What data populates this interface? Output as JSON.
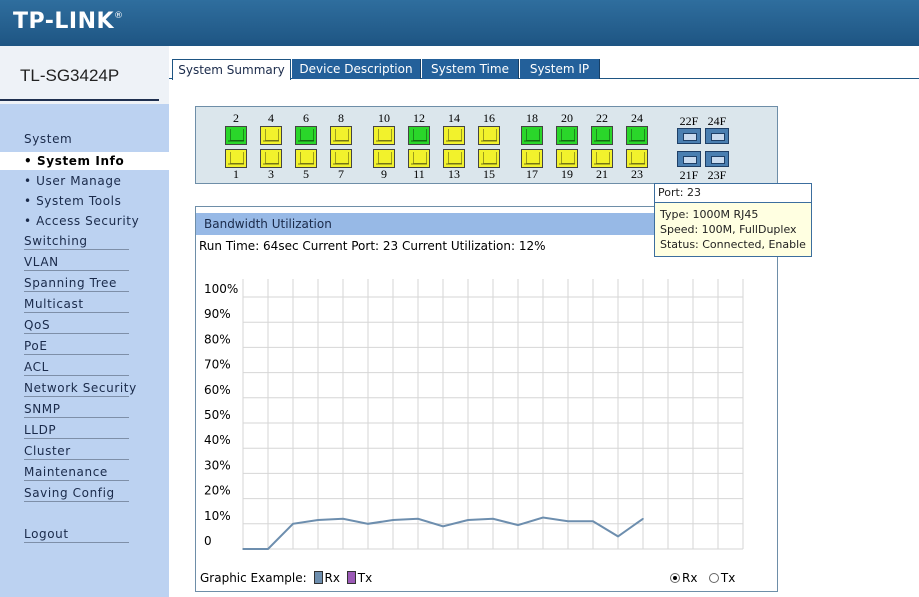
{
  "header": {
    "logo": "TP-LINK",
    "logo_mark": "®"
  },
  "device": {
    "model": "TL-SG3424P"
  },
  "tabs": [
    {
      "label": "System Summary",
      "active": true
    },
    {
      "label": "Device Description",
      "active": false
    },
    {
      "label": "System Time",
      "active": false
    },
    {
      "label": "System IP",
      "active": false
    }
  ],
  "sidebar": {
    "items": [
      {
        "label": "System",
        "sub": false
      },
      {
        "label": "• System Info",
        "sub": true,
        "active": true
      },
      {
        "label": "• User Manage",
        "sub": true
      },
      {
        "label": "• System Tools",
        "sub": true
      },
      {
        "label": "• Access Security",
        "sub": true
      },
      {
        "label": "Switching"
      },
      {
        "label": "VLAN"
      },
      {
        "label": "Spanning Tree"
      },
      {
        "label": "Multicast"
      },
      {
        "label": "QoS"
      },
      {
        "label": "PoE"
      },
      {
        "label": "ACL"
      },
      {
        "label": "Network Security"
      },
      {
        "label": "SNMP"
      },
      {
        "label": "LLDP"
      },
      {
        "label": "Cluster"
      },
      {
        "label": "Maintenance"
      },
      {
        "label": "Saving Config"
      },
      {
        "label": "Logout"
      }
    ]
  },
  "ports": {
    "top": [
      {
        "num": "2",
        "status": "green"
      },
      {
        "num": "4",
        "status": "yellow"
      },
      {
        "num": "6",
        "status": "green"
      },
      {
        "num": "8",
        "status": "yellow"
      },
      {
        "num": "10",
        "status": "yellow"
      },
      {
        "num": "12",
        "status": "green"
      },
      {
        "num": "14",
        "status": "yellow"
      },
      {
        "num": "16",
        "status": "yellow"
      },
      {
        "num": "18",
        "status": "green"
      },
      {
        "num": "20",
        "status": "green"
      },
      {
        "num": "22",
        "status": "green"
      },
      {
        "num": "24",
        "status": "green"
      }
    ],
    "bottom": [
      {
        "num": "1",
        "status": "yellow"
      },
      {
        "num": "3",
        "status": "yellow"
      },
      {
        "num": "5",
        "status": "yellow"
      },
      {
        "num": "7",
        "status": "yellow"
      },
      {
        "num": "9",
        "status": "yellow"
      },
      {
        "num": "11",
        "status": "yellow"
      },
      {
        "num": "13",
        "status": "yellow"
      },
      {
        "num": "15",
        "status": "yellow"
      },
      {
        "num": "17",
        "status": "yellow"
      },
      {
        "num": "19",
        "status": "yellow"
      },
      {
        "num": "21",
        "status": "yellow"
      },
      {
        "num": "23",
        "status": "yellow"
      }
    ],
    "sfp_top": [
      "22F",
      "24F"
    ],
    "sfp_bottom": [
      "21F",
      "23F"
    ]
  },
  "tooltip": {
    "title": "Port: 23",
    "type": "Type: 1000M RJ45",
    "speed": "Speed: 100M, FullDuplex",
    "status": "Status: Connected, Enable"
  },
  "bandwidth": {
    "title": "Bandwidth Utilization",
    "run_info": "Run Time: 64sec Current Port: 23 Current Utilization: 12%",
    "legend_label": "Graphic Example:",
    "rx_label": "Rx",
    "tx_label": "Tx",
    "rx_color": "#6d8eae",
    "tx_color": "#9b59b6",
    "radio_rx": "Rx",
    "radio_tx": "Tx",
    "selected": "Rx"
  },
  "chart_data": {
    "type": "line",
    "y_ticks": [
      "100%",
      "90%",
      "80%",
      "70%",
      "60%",
      "50%",
      "40%",
      "30%",
      "20%",
      "10%",
      "0"
    ],
    "ylim": [
      0,
      100
    ],
    "grid": true,
    "series": [
      {
        "name": "Rx",
        "values": [
          0,
          0,
          10,
          11.5,
          12,
          10,
          11.5,
          12,
          9,
          11.5,
          12,
          9.5,
          12.5,
          11,
          11,
          5,
          12
        ]
      }
    ]
  }
}
